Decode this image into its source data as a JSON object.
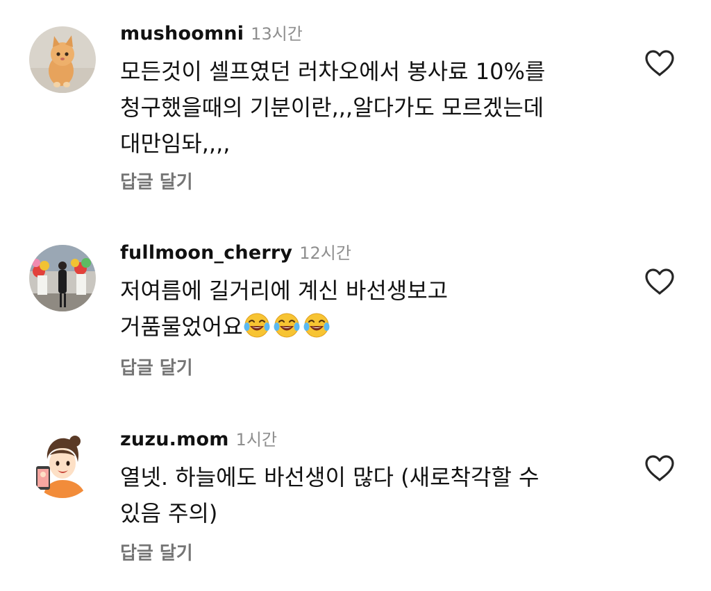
{
  "comments": [
    {
      "username": "mushoomni",
      "time": "13시간",
      "lines": [
        "모든것이 셀프였던 러차오에서 봉사료 10%를",
        "청구했을때의 기분이란,,,알다가도 모르겠는데",
        "대만임돠,,,,"
      ],
      "reply_label": "답글 달기",
      "avatar_icon": "cat-photo-avatar"
    },
    {
      "username": "fullmoon_cherry",
      "time": "12시간",
      "lines": [
        "저여름에 길거리에 계신 바선생보고",
        "거품물었어요"
      ],
      "emoji_count": 3,
      "emoji_icon": "face-with-tears-of-joy-emoji",
      "reply_label": "답글 달기",
      "avatar_icon": "person-with-flowers-photo-avatar"
    },
    {
      "username": "zuzu.mom",
      "time": "1시간",
      "lines": [
        "열넷. 하늘에도 바선생이 많다 (새로착각할 수",
        "있음 주의)"
      ],
      "reply_label": "답글 달기",
      "avatar_icon": "cartoon-woman-avatar"
    }
  ],
  "colors": {
    "text": "#111111",
    "muted": "#8e8e8e",
    "reply": "#757575",
    "heart_stroke": "#262626"
  },
  "icons": {
    "like": "heart-outline-icon"
  }
}
